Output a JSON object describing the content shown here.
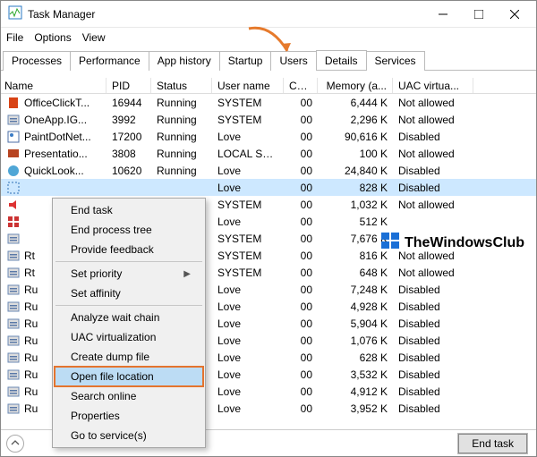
{
  "window": {
    "title": "Task Manager"
  },
  "menu": {
    "file": "File",
    "options": "Options",
    "view": "View"
  },
  "tabs": {
    "processes": "Processes",
    "performance": "Performance",
    "app_history": "App history",
    "startup": "Startup",
    "users": "Users",
    "details": "Details",
    "services": "Services"
  },
  "columns": {
    "name": "Name",
    "pid": "PID",
    "status": "Status",
    "user": "User name",
    "cpu": "CPU",
    "mem": "Memory (a...",
    "uac": "UAC virtua..."
  },
  "rows": [
    {
      "icon": "office",
      "name": "OfficeClickT...",
      "pid": "16944",
      "status": "Running",
      "user": "SYSTEM",
      "cpu": "00",
      "mem": "6,444 K",
      "uac": "Not allowed"
    },
    {
      "icon": "generic",
      "name": "OneApp.IG...",
      "pid": "3992",
      "status": "Running",
      "user": "SYSTEM",
      "cpu": "00",
      "mem": "2,296 K",
      "uac": "Not allowed"
    },
    {
      "icon": "paint",
      "name": "PaintDotNet...",
      "pid": "17200",
      "status": "Running",
      "user": "Love",
      "cpu": "00",
      "mem": "90,616 K",
      "uac": "Disabled"
    },
    {
      "icon": "pres",
      "name": "Presentatio...",
      "pid": "3808",
      "status": "Running",
      "user": "LOCAL SE...",
      "cpu": "00",
      "mem": "100 K",
      "uac": "Not allowed"
    },
    {
      "icon": "quick",
      "name": "QuickLook...",
      "pid": "10620",
      "status": "Running",
      "user": "Love",
      "cpu": "00",
      "mem": "24,840 K",
      "uac": "Disabled"
    },
    {
      "icon": "sel",
      "name": "",
      "pid": "",
      "status": "",
      "user": "Love",
      "cpu": "00",
      "mem": "828 K",
      "uac": "Disabled",
      "selected": true
    },
    {
      "icon": "sound",
      "name": "",
      "pid": "",
      "status": "",
      "user": "SYSTEM",
      "cpu": "00",
      "mem": "1,032 K",
      "uac": "Not allowed"
    },
    {
      "icon": "grid",
      "name": "",
      "pid": "",
      "status": "",
      "user": "Love",
      "cpu": "00",
      "mem": "512 K",
      "uac": ""
    },
    {
      "icon": "gear",
      "name": "",
      "pid": "",
      "status": "",
      "user": "SYSTEM",
      "cpu": "00",
      "mem": "7,676 K",
      "uac": ""
    },
    {
      "icon": "gear",
      "name": "Rt",
      "pid": "",
      "status": "",
      "user": "SYSTEM",
      "cpu": "00",
      "mem": "816 K",
      "uac": "Not allowed"
    },
    {
      "icon": "gear",
      "name": "Rt",
      "pid": "",
      "status": "",
      "user": "SYSTEM",
      "cpu": "00",
      "mem": "648 K",
      "uac": "Not allowed"
    },
    {
      "icon": "gear",
      "name": "Ru",
      "pid": "",
      "status": "",
      "user": "Love",
      "cpu": "00",
      "mem": "7,248 K",
      "uac": "Disabled"
    },
    {
      "icon": "gear",
      "name": "Ru",
      "pid": "",
      "status": "",
      "user": "Love",
      "cpu": "00",
      "mem": "4,928 K",
      "uac": "Disabled"
    },
    {
      "icon": "gear",
      "name": "Ru",
      "pid": "",
      "status": "",
      "user": "Love",
      "cpu": "00",
      "mem": "5,904 K",
      "uac": "Disabled"
    },
    {
      "icon": "gear",
      "name": "Ru",
      "pid": "",
      "status": "",
      "user": "Love",
      "cpu": "00",
      "mem": "1,076 K",
      "uac": "Disabled"
    },
    {
      "icon": "gear",
      "name": "Ru",
      "pid": "",
      "status": "",
      "user": "Love",
      "cpu": "00",
      "mem": "628 K",
      "uac": "Disabled"
    },
    {
      "icon": "gear",
      "name": "Ru",
      "pid": "",
      "status": "",
      "user": "Love",
      "cpu": "00",
      "mem": "3,532 K",
      "uac": "Disabled"
    },
    {
      "icon": "gear",
      "name": "Ru",
      "pid": "",
      "status": "",
      "user": "Love",
      "cpu": "00",
      "mem": "4,912 K",
      "uac": "Disabled"
    },
    {
      "icon": "gear",
      "name": "Ru",
      "pid": "",
      "status": "",
      "user": "Love",
      "cpu": "00",
      "mem": "3,952 K",
      "uac": "Disabled"
    }
  ],
  "context_menu": {
    "end_task": "End task",
    "end_tree": "End process tree",
    "feedback": "Provide feedback",
    "set_priority": "Set priority",
    "set_affinity": "Set affinity",
    "analyze": "Analyze wait chain",
    "uac": "UAC virtualization",
    "dump": "Create dump file",
    "open_loc": "Open file location",
    "search": "Search online",
    "props": "Properties",
    "goto": "Go to service(s)"
  },
  "footer": {
    "end_task": "End task"
  },
  "watermark": "TheWindowsClub"
}
